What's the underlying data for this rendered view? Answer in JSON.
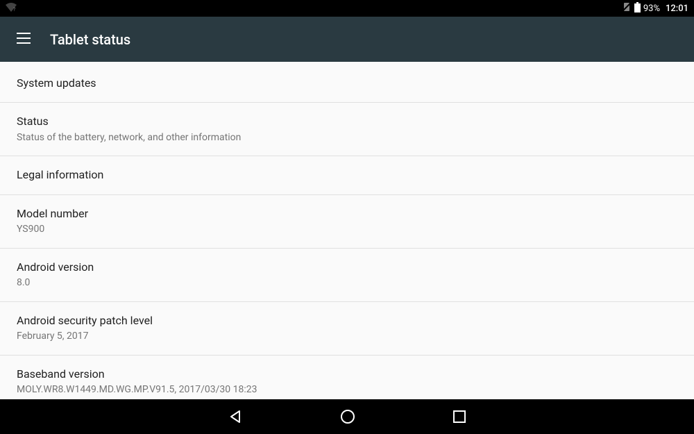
{
  "statusBar": {
    "battery": "93%",
    "time": "12:01"
  },
  "appBar": {
    "title": "Tablet status"
  },
  "settings": [
    {
      "title": "System updates",
      "subtitle": null
    },
    {
      "title": "Status",
      "subtitle": "Status of the battery, network, and other information"
    },
    {
      "title": "Legal information",
      "subtitle": null
    },
    {
      "title": "Model number",
      "subtitle": "YS900"
    },
    {
      "title": "Android version",
      "subtitle": "8.0"
    },
    {
      "title": "Android security patch level",
      "subtitle": "February 5, 2017"
    },
    {
      "title": "Baseband version",
      "subtitle": "MOLY.WR8.W1449.MD.WG.MP.V91.5, 2017/03/30 18:23"
    }
  ]
}
